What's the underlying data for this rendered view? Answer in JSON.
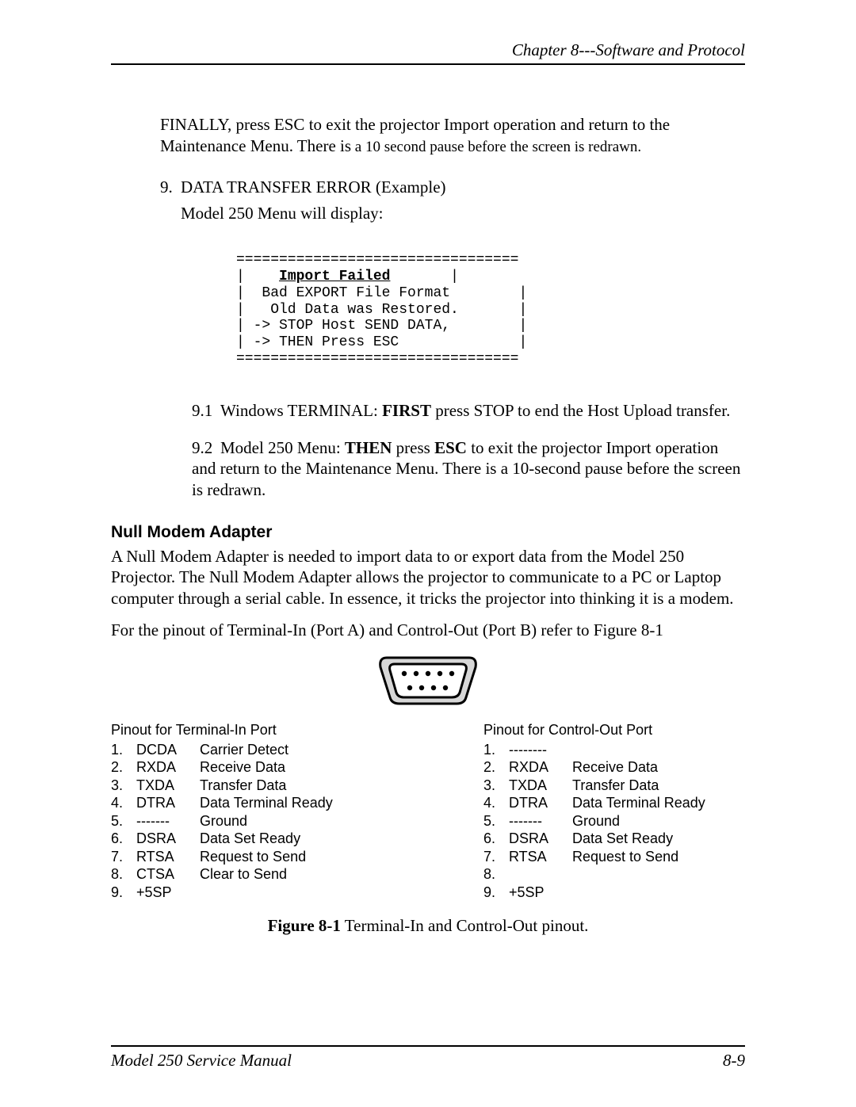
{
  "header": {
    "text": "Chapter 8---Software and Protocol"
  },
  "footer": {
    "left": "Model 250 Service Manual",
    "right": "8-9"
  },
  "p_finally_a": "FINALLY, press ESC to exit the projector Import operation and return to the Maintenance Menu. There is",
  "p_finally_b": " a 10 second pause before the screen is redrawn.",
  "item9": {
    "num": "9.",
    "title": "DATA TRANSFER ERROR (Example)",
    "line2": "Model 250 Menu will display:"
  },
  "code": {
    "top": "=================================",
    "l1_a": "|    ",
    "l1_bold": "Import Failed",
    "l1_b": "       |",
    "l2": "|  Bad EXPORT File Format        |",
    "l3": "|   Old Data was Restored.       |",
    "l4": "| -> STOP Host SEND DATA,        |",
    "l5": "| -> THEN Press ESC              |",
    "bot": "================================="
  },
  "sub91": {
    "num": "9.1",
    "a": "Windows TERMINAL: ",
    "b": "FIRST",
    "c": " press STOP to end the Host Upload transfer."
  },
  "sub92": {
    "num": "9.2",
    "a": "Model 250 Menu: ",
    "b": "THEN",
    "c": " press ",
    "d": "ESC",
    "e": " to exit the projector Import operation and return        to the Maintenance Menu. There is a 10-second pause before the screen is redrawn."
  },
  "null_modem": {
    "title": "Null Modem Adapter",
    "p1": "A Null Modem Adapter is needed to import data to or export data from the Model 250 Projector. The Null Modem Adapter allows the projector to communicate to a PC or Laptop computer through a serial cable. In essence, it tricks the projector into thinking it is a modem.",
    "p2": "For the pinout of Terminal-In (Port A) and Control-Out (Port B) refer to Figure 8-1"
  },
  "pinout": {
    "left_title": "Pinout for Terminal-In Port",
    "right_title": "Pinout for Control-Out Port",
    "left": [
      {
        "n": "1.",
        "sig": "DCDA",
        "desc": "Carrier Detect"
      },
      {
        "n": "2.",
        "sig": "RXDA",
        "desc": "Receive Data"
      },
      {
        "n": "3.",
        "sig": "TXDA",
        "desc": "Transfer Data"
      },
      {
        "n": "4.",
        "sig": "DTRA",
        "desc": "Data Terminal Ready"
      },
      {
        "n": "5.",
        "sig": "-------",
        "desc": "Ground"
      },
      {
        "n": "6.",
        "sig": "DSRA",
        "desc": "Data Set Ready"
      },
      {
        "n": "7.",
        "sig": "RTSA",
        "desc": "Request to Send"
      },
      {
        "n": "8.",
        "sig": "CTSA",
        "desc": "Clear to Send"
      },
      {
        "n": "9.",
        "sig": "+5SP",
        "desc": ""
      }
    ],
    "right": [
      {
        "n": "1.",
        "sig": "--------",
        "desc": ""
      },
      {
        "n": "2.",
        "sig": "RXDA",
        "desc": "Receive Data"
      },
      {
        "n": "3.",
        "sig": "TXDA",
        "desc": "Transfer Data"
      },
      {
        "n": "4.",
        "sig": "DTRA",
        "desc": "Data Terminal Ready"
      },
      {
        "n": "5.",
        "sig": "-------",
        "desc": "Ground"
      },
      {
        "n": "6.",
        "sig": "DSRA",
        "desc": "Data Set Ready"
      },
      {
        "n": "7.",
        "sig": "RTSA",
        "desc": "Request to Send"
      },
      {
        "n": "8.",
        "sig": "",
        "desc": ""
      },
      {
        "n": "9.",
        "sig": "+5SP",
        "desc": ""
      }
    ]
  },
  "figcap": {
    "bold": "Figure 8-1",
    "rest": "   Terminal-In and Control-Out pinout."
  }
}
